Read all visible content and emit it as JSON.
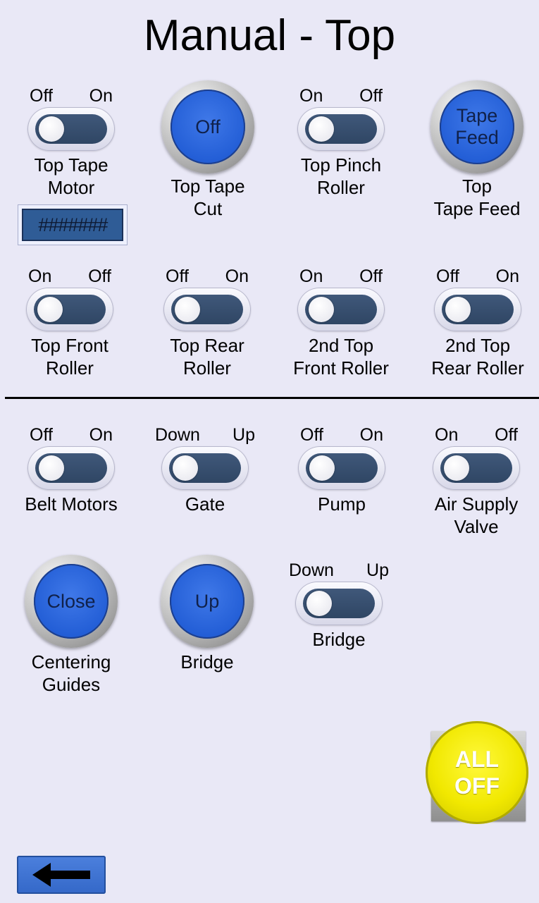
{
  "title": "Manual - Top",
  "top_tape_motor": {
    "left": "Off",
    "right": "On",
    "label1": "Top Tape",
    "label2": "Motor",
    "display_value": "#######"
  },
  "top_tape_cut": {
    "button": "Off",
    "label1": "Top Tape",
    "label2": "Cut"
  },
  "top_pinch_roller": {
    "left": "On",
    "right": "Off",
    "label1": "Top Pinch",
    "label2": "Roller"
  },
  "top_tape_feed": {
    "button1": "Tape",
    "button2": "Feed",
    "label1": "Top",
    "label2": "Tape Feed"
  },
  "top_front_roller": {
    "left": "On",
    "right": "Off",
    "label1": "Top Front",
    "label2": "Roller"
  },
  "top_rear_roller": {
    "left": "Off",
    "right": "On",
    "label1": "Top Rear",
    "label2": "Roller"
  },
  "second_top_front_roller": {
    "left": "On",
    "right": "Off",
    "label1": "2nd Top",
    "label2": "Front Roller"
  },
  "second_top_rear_roller": {
    "left": "Off",
    "right": "On",
    "label1": "2nd Top",
    "label2": "Rear Roller"
  },
  "belt_motors": {
    "left": "Off",
    "right": "On",
    "label1": "Belt Motors"
  },
  "gate": {
    "left": "Down",
    "right": "Up",
    "label1": "Gate"
  },
  "pump": {
    "left": "Off",
    "right": "On",
    "label1": "Pump"
  },
  "air_supply_valve": {
    "left": "On",
    "right": "Off",
    "label1": "Air Supply",
    "label2": "Valve"
  },
  "centering_guides": {
    "button": "Close",
    "label1": "Centering",
    "label2": "Guides"
  },
  "bridge_button": {
    "button": "Up",
    "label1": "Bridge"
  },
  "bridge_toggle": {
    "left": "Down",
    "right": "Up",
    "label1": "Bridge"
  },
  "all_off": {
    "line1": "ALL",
    "line2": "OFF"
  },
  "icons": {
    "back": "left-arrow-icon"
  },
  "colors": {
    "background": "#e9e8f6",
    "button_blue": "#235ed6",
    "toggle_track": "#2f4664",
    "all_off_yellow": "#f1e800"
  }
}
